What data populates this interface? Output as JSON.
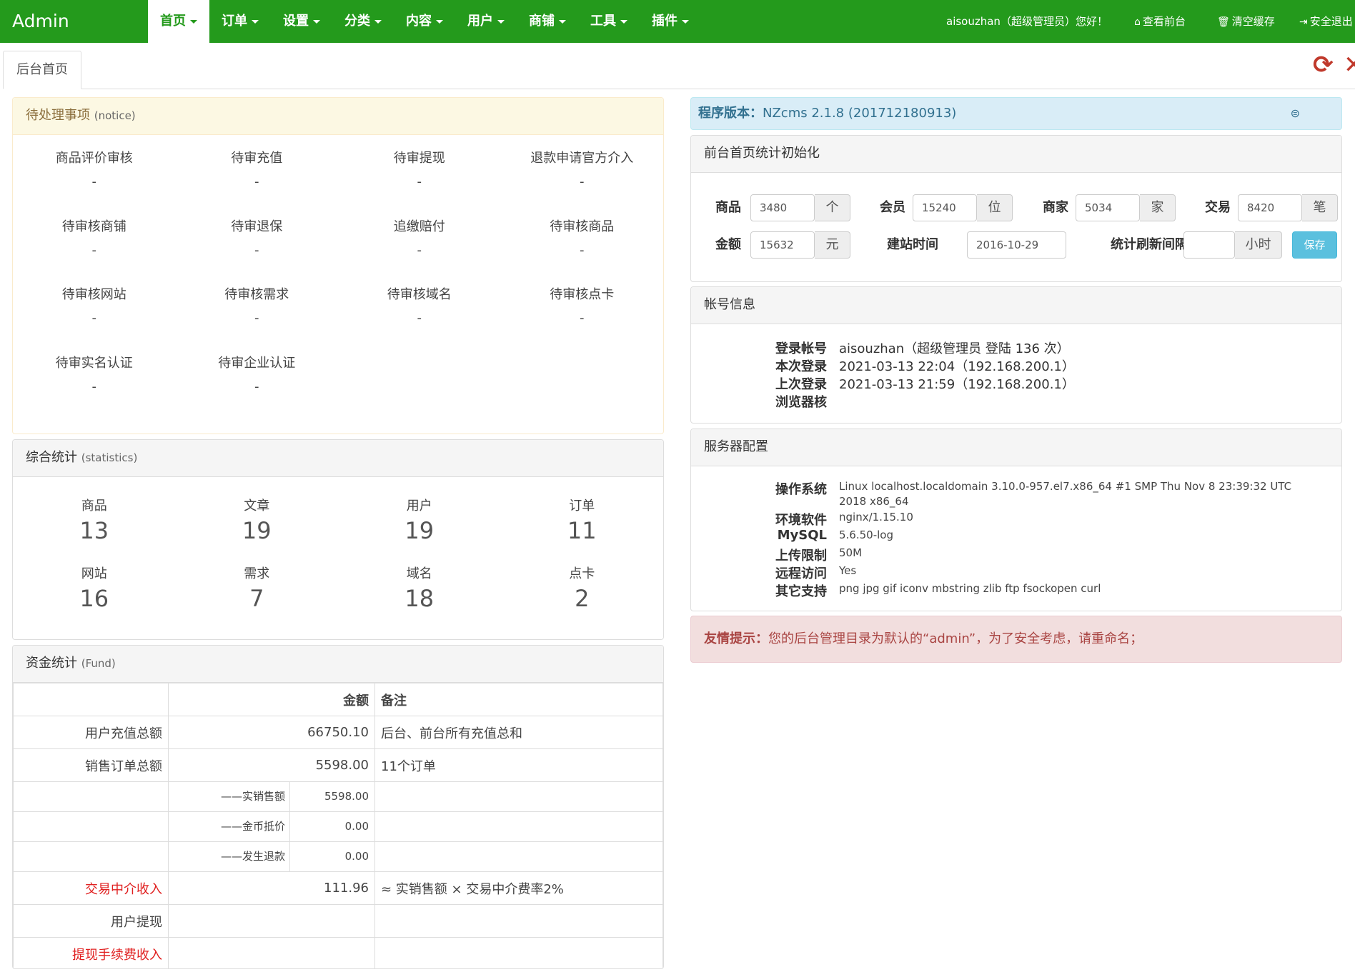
{
  "navbar": {
    "brand": "Admin",
    "menu": [
      {
        "label": "首页",
        "active": true
      },
      {
        "label": "订单"
      },
      {
        "label": "设置"
      },
      {
        "label": "分类"
      },
      {
        "label": "内容"
      },
      {
        "label": "用户"
      },
      {
        "label": "商铺"
      },
      {
        "label": "工具"
      },
      {
        "label": "插件"
      }
    ],
    "greeting": "aisouzhan（超级管理员）您好！",
    "view_frontend": "查看前台",
    "clear_cache": "清空缓存",
    "logout": "安全退出"
  },
  "tabs": {
    "active": "后台首页"
  },
  "notice": {
    "title": "待处理事项",
    "subtitle": "(notice)",
    "items": [
      {
        "label": "商品评价审核",
        "value": "-"
      },
      {
        "label": "待审充值",
        "value": "-"
      },
      {
        "label": "待审提现",
        "value": "-"
      },
      {
        "label": "退款申请官方介入",
        "value": "-"
      },
      {
        "label": "待审核商铺",
        "value": "-"
      },
      {
        "label": "待审退保",
        "value": "-"
      },
      {
        "label": "追缴赔付",
        "value": "-"
      },
      {
        "label": "待审核商品",
        "value": "-"
      },
      {
        "label": "待审核网站",
        "value": "-"
      },
      {
        "label": "待审核需求",
        "value": "-"
      },
      {
        "label": "待审核域名",
        "value": "-"
      },
      {
        "label": "待审核点卡",
        "value": "-"
      },
      {
        "label": "待审实名认证",
        "value": "-"
      },
      {
        "label": "待审企业认证",
        "value": "-"
      }
    ]
  },
  "statistics": {
    "title": "综合统计",
    "subtitle": "(statistics)",
    "items": [
      {
        "label": "商品",
        "value": "13"
      },
      {
        "label": "文章",
        "value": "19"
      },
      {
        "label": "用户",
        "value": "19"
      },
      {
        "label": "订单",
        "value": "11"
      },
      {
        "label": "网站",
        "value": "16"
      },
      {
        "label": "需求",
        "value": "7"
      },
      {
        "label": "域名",
        "value": "18"
      },
      {
        "label": "点卡",
        "value": "2"
      }
    ]
  },
  "fund": {
    "title": "资金统计",
    "subtitle": "(Fund)",
    "headers": {
      "amount": "金额",
      "note": "备注"
    },
    "rows": [
      {
        "label": "用户充值总额",
        "sub": "",
        "amount": "66750.10",
        "note": "后台、前台所有充值总和",
        "red": false
      },
      {
        "label": "销售订单总额",
        "sub": "",
        "amount": "5598.00",
        "note": "11个订单",
        "red": false
      },
      {
        "label": "",
        "sub": "——实销售额",
        "amount": "5598.00",
        "note": "",
        "red": false
      },
      {
        "label": "",
        "sub": "——金币抵价",
        "amount": "0.00",
        "note": "",
        "red": false
      },
      {
        "label": "",
        "sub": "——发生退款",
        "amount": "0.00",
        "note": "",
        "red": false
      },
      {
        "label": "交易中介收入",
        "sub": "",
        "amount": "111.96",
        "note": "≈ 实销售额 × 交易中介费率2%",
        "red": true
      },
      {
        "label": "用户提现",
        "sub": "",
        "amount": "",
        "note": "",
        "red": false
      },
      {
        "label": "提现手续费收入",
        "sub": "",
        "amount": "",
        "note": "",
        "red": true
      }
    ]
  },
  "version": {
    "label": "程序版本：",
    "value": "NZcms 2.1.8 (201712180913)"
  },
  "init": {
    "title": "前台首页统计初始化",
    "goods_label": "商品",
    "goods_value": "3480",
    "goods_unit": "个",
    "member_label": "会员",
    "member_value": "15240",
    "member_unit": "位",
    "merchant_label": "商家",
    "merchant_value": "5034",
    "merchant_unit": "家",
    "trade_label": "交易",
    "trade_value": "8420",
    "trade_unit": "笔",
    "amount_label": "金额",
    "amount_value": "15632",
    "amount_unit": "元",
    "build_label": "建站时间",
    "build_value": "2016-10-29",
    "refresh_label": "统计刷新间隔",
    "refresh_value": "",
    "refresh_unit": "小时",
    "save": "保存"
  },
  "account": {
    "title": "帐号信息",
    "rows": [
      {
        "k": "登录帐号",
        "v": "aisouzhan（超级管理员 登陆 136 次）"
      },
      {
        "k": "本次登录",
        "v": "2021-03-13 22:04（192.168.200.1）"
      },
      {
        "k": "上次登录",
        "v": "2021-03-13 21:59（192.168.200.1）"
      },
      {
        "k": "浏览器核",
        "v": ""
      }
    ]
  },
  "server": {
    "title": "服务器配置",
    "rows": [
      {
        "k": "操作系统",
        "v": "Linux localhost.localdomain 3.10.0-957.el7.x86_64 #1 SMP Thu Nov 8 23:39:32 UTC 2018 x86_64"
      },
      {
        "k": "环境软件",
        "v": "nginx/1.15.10"
      },
      {
        "k": "MySQL",
        "v": "5.6.50-log"
      },
      {
        "k": "上传限制",
        "v": "50M"
      },
      {
        "k": "远程访问",
        "v": "Yes"
      },
      {
        "k": "其它支持",
        "v": "png jpg gif iconv mbstring zlib ftp fsockopen curl"
      }
    ]
  },
  "alert": {
    "title": "友情提示：",
    "text": "您的后台管理目录为默认的“admin”，为了安全考虑，请重命名；"
  },
  "icons": [
    "home-icon",
    "trash-icon",
    "logout-icon",
    "refresh-icon",
    "close-icon",
    "collapse-icon"
  ],
  "colors": {
    "nav_bg": "#249a1c",
    "info_bg": "#d9edf7",
    "alert_bg": "#f2dede",
    "notice_bg": "#fcf8e3",
    "red": "#e02020"
  }
}
